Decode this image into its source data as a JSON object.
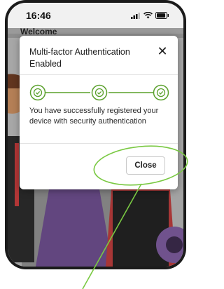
{
  "status_bar": {
    "time": "16:46"
  },
  "background": {
    "heading": "Welcome"
  },
  "modal": {
    "title": "Multi-factor Authentication Enabled",
    "close_icon": "close-icon",
    "steps_completed": 3,
    "steps_total": 3,
    "message": "You have successfully registered your device with security authentication",
    "close_button_label": "Close",
    "accent_color": "#5aa02c"
  },
  "annotation": {
    "color": "#7ac943"
  }
}
